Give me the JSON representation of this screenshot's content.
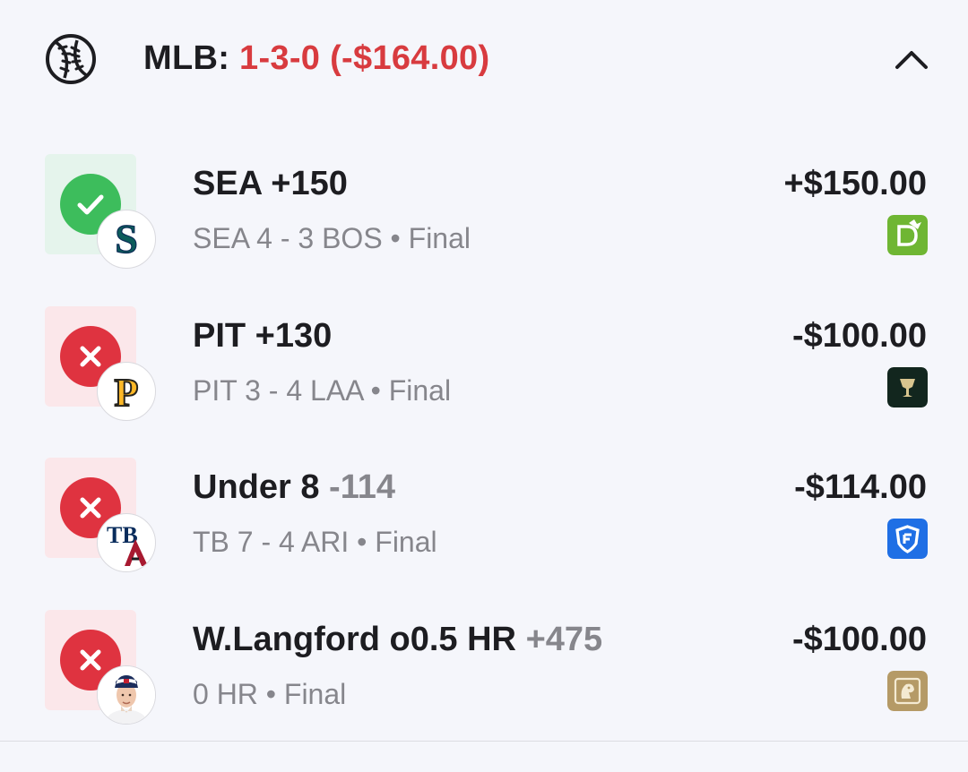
{
  "header": {
    "sport_icon": "baseball-icon",
    "league_label": "MLB: ",
    "record_summary": "1-3-0 (-$164.00)",
    "collapse_icon": "chevron-up-icon"
  },
  "bets": [
    {
      "result": "win",
      "result_icon": "check-icon",
      "team_logo": "mariners-logo-icon",
      "title": "SEA +150",
      "odds": "",
      "subtitle": "SEA 4 - 3 BOS • Final",
      "amount": "+$150.00",
      "book_logo": "draftkings-logo-icon"
    },
    {
      "result": "loss",
      "result_icon": "x-icon",
      "team_logo": "pirates-logo-icon",
      "title": "PIT +130",
      "odds": "",
      "subtitle": "PIT 3 - 4 LAA • Final",
      "amount": "-$100.00",
      "book_logo": "hard-rock-bet-logo-icon"
    },
    {
      "result": "loss",
      "result_icon": "x-icon",
      "team_logo": "rays-diamondbacks-logo-icon",
      "title": "Under 8 ",
      "odds": "-114",
      "subtitle": "TB 7 - 4 ARI • Final",
      "amount": "-$114.00",
      "book_logo": "fanduel-logo-icon"
    },
    {
      "result": "loss",
      "result_icon": "x-icon",
      "team_logo": "player-headshot-icon",
      "title": "W.Langford o0.5 HR ",
      "odds": "+475",
      "subtitle": "0 HR • Final",
      "amount": "-$100.00",
      "book_logo": "betmgm-logo-icon"
    }
  ],
  "colors": {
    "record_red": "#d83b3f",
    "win_green": "#3dbd5c",
    "loss_red": "#df3340",
    "muted_text": "#86868c"
  }
}
